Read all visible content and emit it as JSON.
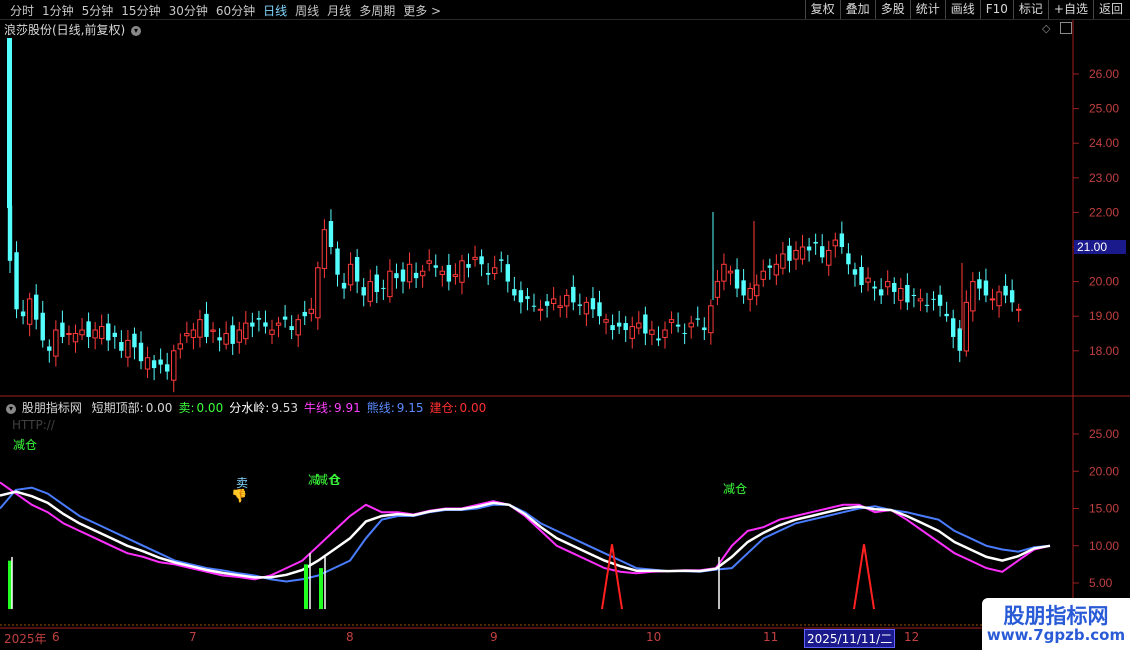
{
  "toolbar": {
    "tabs": [
      "分时",
      "1分钟",
      "5分钟",
      "15分钟",
      "30分钟",
      "60分钟",
      "日线",
      "周线",
      "月线",
      "多周期",
      "更多 >"
    ],
    "active_tab": "日线",
    "right_buttons": [
      "复权",
      "叠加",
      "多股",
      "统计",
      "画线",
      "F10",
      "标记",
      "+自选",
      "返回"
    ]
  },
  "price_panel": {
    "title": "浪莎股份(日线,前复权)",
    "y_ticks": [
      "26.00",
      "25.00",
      "24.00",
      "23.00",
      "22.00",
      "21.00",
      "20.00",
      "19.00",
      "18.00"
    ],
    "current_price_label": "21.00",
    "colors": {
      "up": "#ff3b3b",
      "down": "#54ffff",
      "axis": "#c04040",
      "highlight_bg": "#1a1a8c"
    }
  },
  "indicator_panel": {
    "name": "股朋指标网",
    "values": [
      {
        "label": "短期顶部:",
        "value": "0.00",
        "color": "#ffffff"
      },
      {
        "label": "卖:",
        "value": "0.00",
        "color": "#3cff3c"
      },
      {
        "label": "分水岭:",
        "value": "9.53",
        "color": "#ffffff"
      },
      {
        "label": "牛线:",
        "value": "9.91",
        "color": "#ff40ff"
      },
      {
        "label": "熊线:",
        "value": "9.15",
        "color": "#5a8cff"
      },
      {
        "label": "建仓:",
        "value": "0.00",
        "color": "#ff3030"
      }
    ],
    "http_text": "HTTP://",
    "y_ticks": [
      "25.00",
      "20.00",
      "15.00",
      "10.00",
      "5.00"
    ],
    "annotations": [
      {
        "text": "减仓",
        "color": "#3cff3c"
      },
      {
        "text": "卖",
        "color": "#7fd6ff"
      },
      {
        "text": "减仓",
        "color": "#3cff3c"
      },
      {
        "text": "减仓",
        "color": "#3cff3c"
      }
    ],
    "colors": {
      "bull": "#ff30ff",
      "bear": "#4a7dff",
      "divide": "#ffffff",
      "build": "#ff2020",
      "sell": "#20ff20"
    }
  },
  "date_axis": {
    "labels": [
      "2025年",
      "6",
      "7",
      "8",
      "9",
      "10",
      "11",
      "12"
    ],
    "highlight": "2025/11/11/二"
  },
  "watermark": {
    "title": "股朋指标网",
    "url": "www.7gpzb.com"
  }
}
